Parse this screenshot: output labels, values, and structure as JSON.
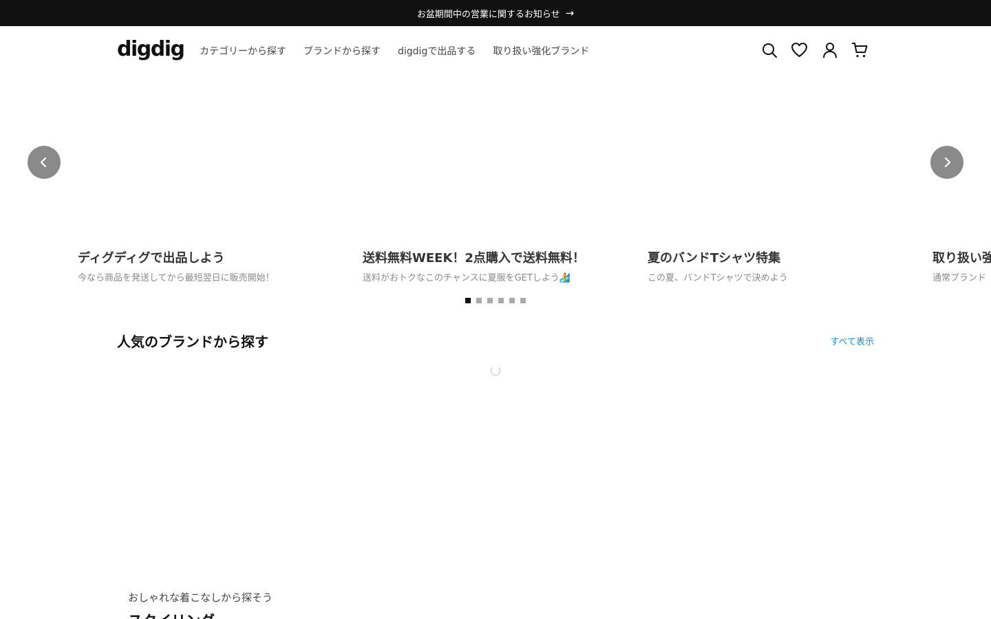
{
  "announcement": {
    "text": "お盆期間中の営業に関するお知らせ",
    "arrow_icon": "arrow-right-icon"
  },
  "header": {
    "logo": "digdig",
    "nav": [
      {
        "label": "カテゴリーから探す"
      },
      {
        "label": "ブランドから探す"
      },
      {
        "label": "digdigで出品する"
      },
      {
        "label": "取り扱い強化ブランド"
      }
    ],
    "icons": [
      "search-icon",
      "heart-icon",
      "user-icon",
      "cart-icon"
    ]
  },
  "carousel": {
    "slides": [
      {
        "title": "ディグディグで出品しよう",
        "subtitle": "今なら商品を発送してから最短翌日に販売開始！"
      },
      {
        "title": "送料無料WEEK！2点購入で送料無料！",
        "subtitle": "送料がおトクなこのチャンスに夏服をGETしよう🏄"
      },
      {
        "title": "夏のバンドTシャツ特集",
        "subtitle": "この夏、バンドTシャツで決めよう"
      },
      {
        "title": "取り扱い強化ブランド",
        "subtitle": "通常ブランド"
      }
    ],
    "dots_count": 6,
    "active_dot": 0
  },
  "popular_brands": {
    "title": "人気のブランドから探す",
    "see_all": "すべて表示"
  },
  "styling": {
    "kicker": "おしゃれな着こなしから探そう",
    "heading": "スタイリング"
  },
  "colors": {
    "announce_bg": "#111111",
    "link": "#1a8fd0",
    "nav_button": "#8a8a8a"
  }
}
